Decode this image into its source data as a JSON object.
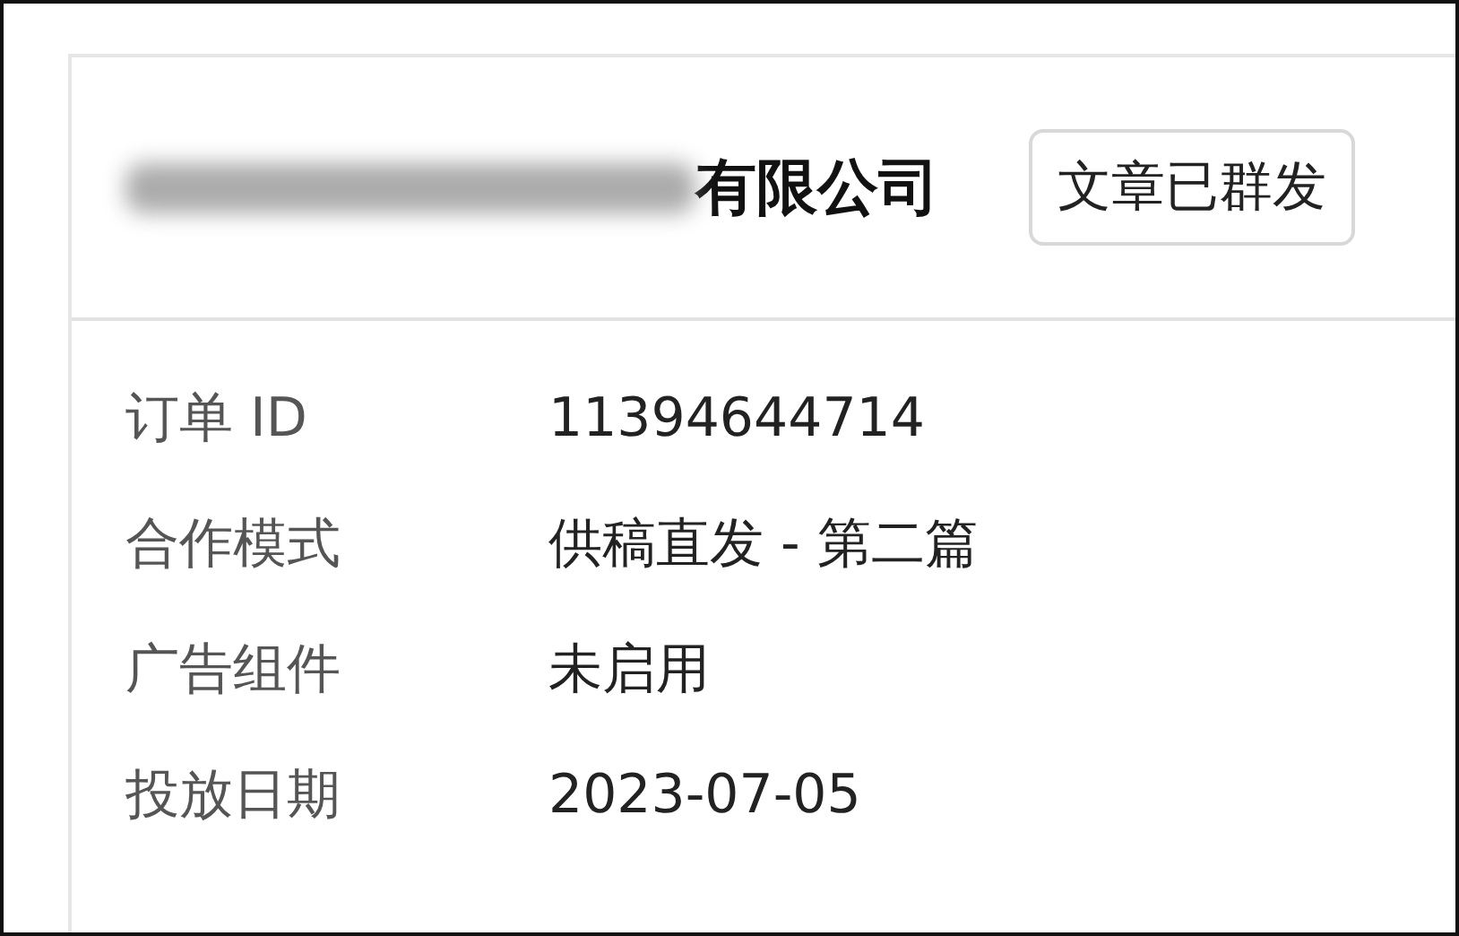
{
  "header": {
    "title_redacted": true,
    "title": "有限公司",
    "status_button": "文章已群发"
  },
  "details": [
    {
      "label": "订单 ID",
      "value": "11394644714"
    },
    {
      "label": "合作模式",
      "value": "供稿直发 - 第二篇"
    },
    {
      "label": "广告组件",
      "value": "未启用"
    },
    {
      "label": "投放日期",
      "value": "2023-07-05"
    }
  ]
}
